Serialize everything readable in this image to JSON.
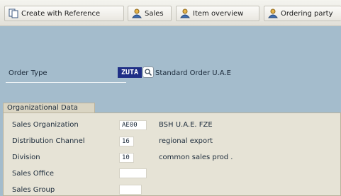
{
  "toolbar": {
    "buttons": [
      {
        "label": "Create with Reference",
        "icon": "create-with-reference-icon"
      },
      {
        "label": "Sales",
        "icon": "person-icon"
      },
      {
        "label": "Item overview",
        "icon": "person-icon"
      },
      {
        "label": "Ordering party",
        "icon": "person-icon"
      }
    ]
  },
  "order": {
    "type_label": "Order Type",
    "type_value": "ZUTA",
    "type_description": "Standard Order U.A.E"
  },
  "org_data": {
    "title": "Organizational Data",
    "fields": [
      {
        "label": "Sales Organization",
        "value": "AE00",
        "description": "BSH U.A.E. FZE"
      },
      {
        "label": "Distribution Channel",
        "value": "16",
        "description": "regional export"
      },
      {
        "label": "Division",
        "value": "10",
        "description": "common sales prod ."
      },
      {
        "label": "Sales Office",
        "value": "",
        "description": ""
      },
      {
        "label": "Sales Group",
        "value": "",
        "description": ""
      }
    ]
  },
  "colors": {
    "background": "#a4bccc",
    "group_background": "#e6e3d6",
    "selected_field": "#1f2f86"
  }
}
